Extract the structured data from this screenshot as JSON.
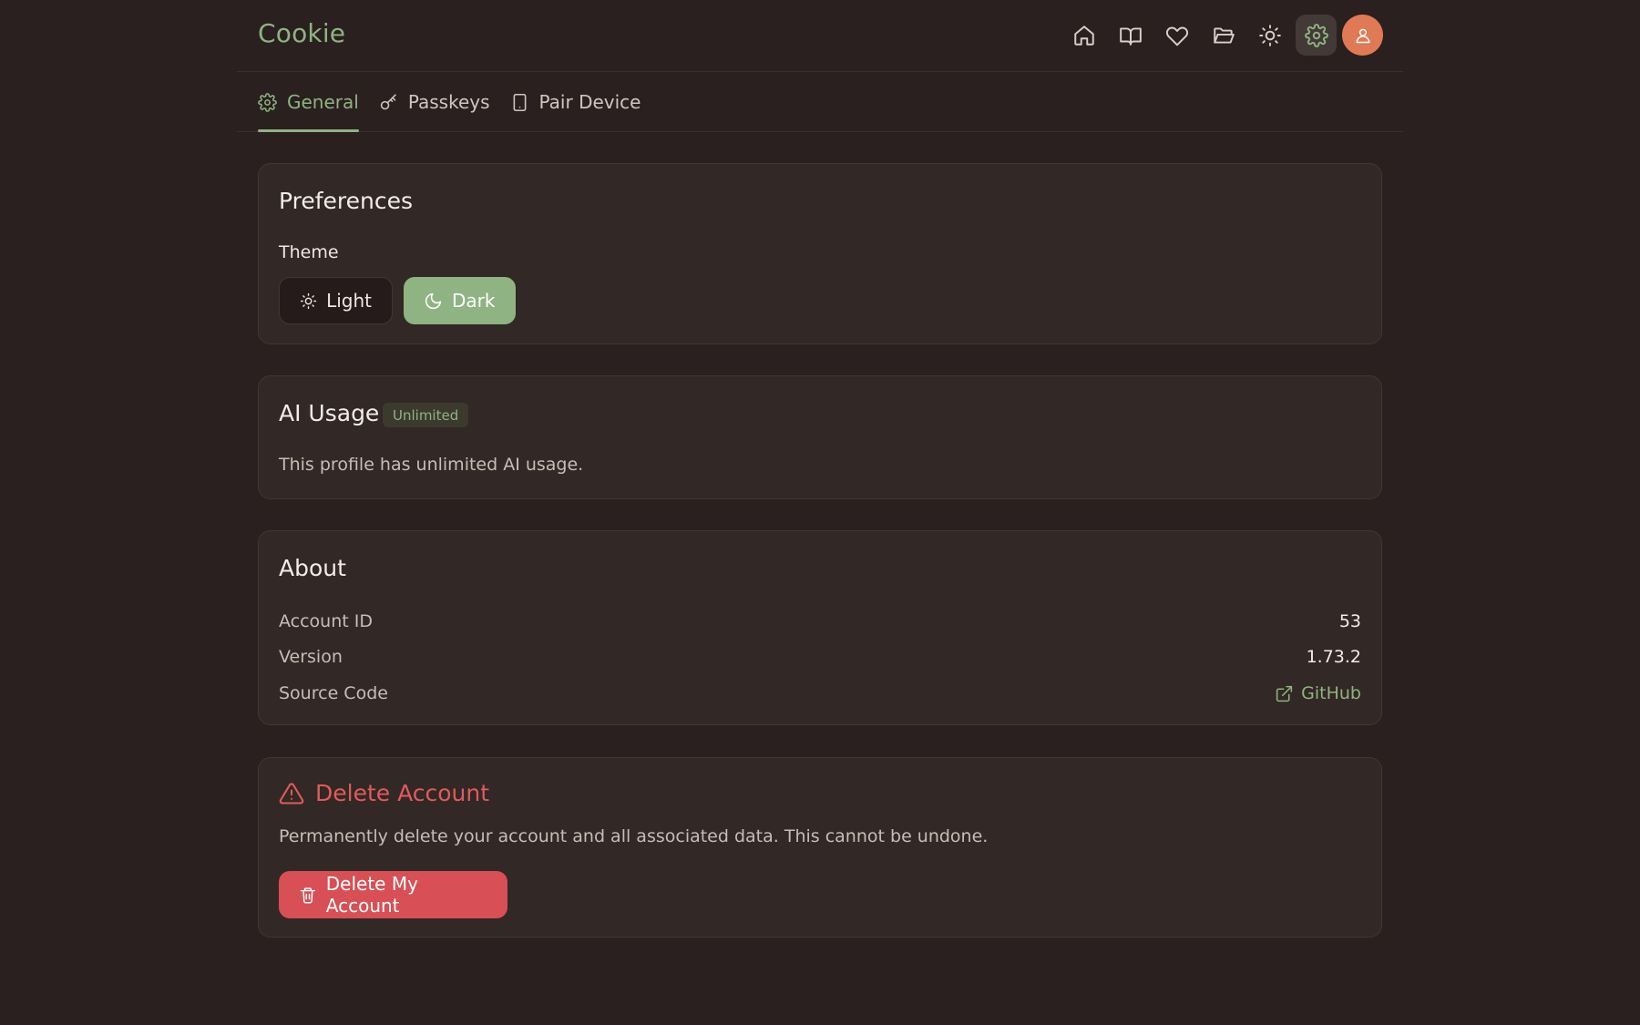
{
  "header": {
    "brand": "Cookie",
    "nav": [
      {
        "icon": "home-icon"
      },
      {
        "icon": "book-icon"
      },
      {
        "icon": "heart-icon"
      },
      {
        "icon": "folder-open-icon"
      },
      {
        "icon": "sun-icon"
      },
      {
        "icon": "gear-icon",
        "active": true
      },
      {
        "icon": "user-icon"
      }
    ]
  },
  "tabs": [
    {
      "label": "General",
      "icon": "gear-icon",
      "active": true
    },
    {
      "label": "Passkeys",
      "icon": "key-icon"
    },
    {
      "label": "Pair Device",
      "icon": "tablet-icon"
    }
  ],
  "preferences": {
    "title": "Preferences",
    "theme_label": "Theme",
    "light_label": "Light",
    "dark_label": "Dark",
    "selected": "Dark"
  },
  "ai_usage": {
    "title": "AI Usage",
    "badge": "Unlimited",
    "description": "This profile has unlimited AI usage."
  },
  "about": {
    "title": "About",
    "rows": [
      {
        "key": "Account ID",
        "value": "53"
      },
      {
        "key": "Version",
        "value": "1.73.2"
      },
      {
        "key": "Source Code",
        "value": "GitHub"
      }
    ]
  },
  "danger": {
    "title": "Delete Account",
    "description": "Permanently delete your account and all associated data. This cannot be undone.",
    "button_label": "Delete My Account"
  },
  "colors": {
    "background": "#2a201f",
    "accent": "#8fb382",
    "danger": "#d84f55",
    "avatar": "#e07a55"
  }
}
